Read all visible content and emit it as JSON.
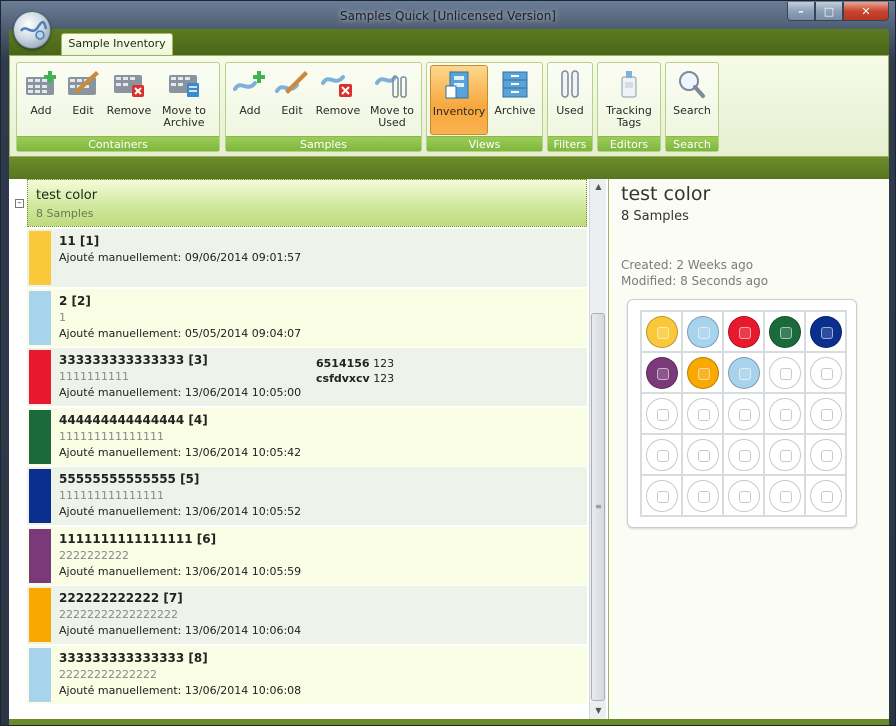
{
  "window": {
    "title": "Samples Quick [Unlicensed Version]"
  },
  "tabs": [
    "Sample Inventory"
  ],
  "ribbon": {
    "groups": [
      {
        "label": "Containers",
        "buttons": [
          "Add",
          "Edit",
          "Remove",
          "Move to Archive"
        ]
      },
      {
        "label": "Samples",
        "buttons": [
          "Add",
          "Edit",
          "Remove",
          "Move to Used"
        ]
      },
      {
        "label": "Views",
        "buttons": [
          "Inventory",
          "Archive"
        ]
      },
      {
        "label": "Filters",
        "buttons": [
          "Used"
        ]
      },
      {
        "label": "Editors",
        "buttons": [
          "Tracking Tags"
        ]
      },
      {
        "label": "Search",
        "buttons": [
          "Search"
        ]
      }
    ],
    "active_button": "Inventory"
  },
  "list": {
    "group": {
      "title": "test color",
      "subtitle": "8 Samples"
    },
    "samples": [
      {
        "title": "11 [1]",
        "sub": "",
        "added": "Ajouté manuellement: 09/06/2014 09:01:57",
        "color": "#f9c93a"
      },
      {
        "title": "2 [2]",
        "sub": "1",
        "added": "Ajouté manuellement: 05/05/2014 09:04:07",
        "color": "#a7d3ec"
      },
      {
        "title": "333333333333333 [3]",
        "sub": "1111111111",
        "added": "Ajouté manuellement: 13/06/2014 10:05:00",
        "color": "#e8192c",
        "props": [
          {
            "key": "6514156",
            "value": "123"
          },
          {
            "key": "csfdvxcv",
            "value": "123"
          }
        ]
      },
      {
        "title": "444444444444444 [4]",
        "sub": "111111111111111",
        "added": "Ajouté manuellement: 13/06/2014 10:05:42",
        "color": "#1a6a3c"
      },
      {
        "title": "55555555555555 [5]",
        "sub": "111111111111111",
        "added": "Ajouté manuellement: 13/06/2014 10:05:52",
        "color": "#0b2f8f"
      },
      {
        "title": "1111111111111111 [6]",
        "sub": "2222222222",
        "added": "Ajouté manuellement: 13/06/2014 10:05:59",
        "color": "#7a3a7a"
      },
      {
        "title": "222222222222 [7]",
        "sub": "22222222222222222",
        "added": "Ajouté manuellement: 13/06/2014 10:06:04",
        "color": "#f9a800"
      },
      {
        "title": "333333333333333 [8]",
        "sub": "22222222222222",
        "added": "Ajouté manuellement: 13/06/2014 10:06:08",
        "color": "#a7d3ec"
      }
    ]
  },
  "details": {
    "title": "test color",
    "count": "8 Samples",
    "created": "Created: 2 Weeks ago",
    "modified": "Modified: 8 Seconds ago",
    "plate": {
      "rows": 5,
      "cols": 5,
      "filled_colors": [
        "#f9c93a",
        "#a7d3ec",
        "#e8192c",
        "#1a6a3c",
        "#0b2f8f",
        "#7a3a7a",
        "#f9a800",
        "#a7d3ec"
      ]
    }
  }
}
